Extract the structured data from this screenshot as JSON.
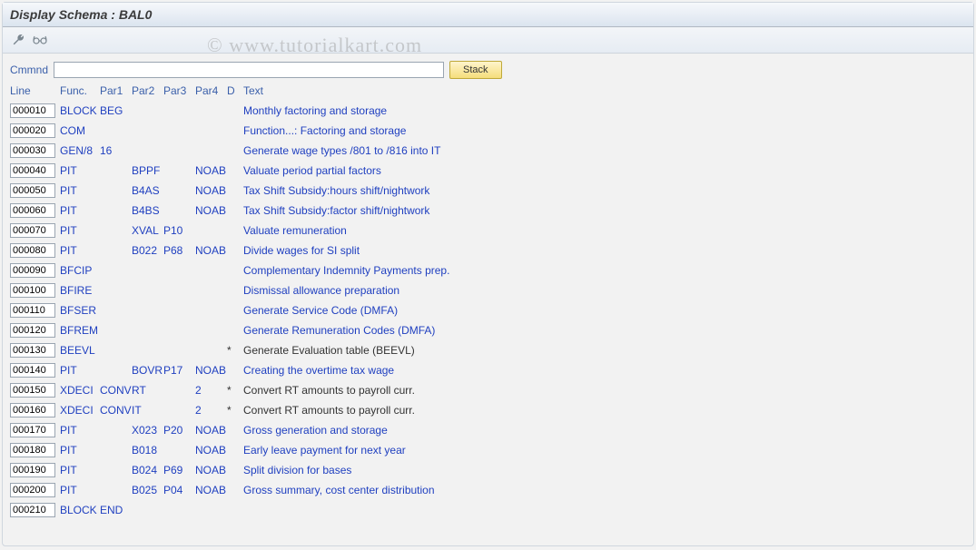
{
  "title": "Display Schema : BAL0",
  "watermark": "© www.tutorialkart.com",
  "toolbar": {
    "icon1_name": "wrench-icon",
    "icon2_name": "glasses-icon"
  },
  "command": {
    "label": "Cmmnd",
    "value": "",
    "stack_label": "Stack"
  },
  "headers": {
    "line": "Line",
    "func": "Func.",
    "par1": "Par1",
    "par2": "Par2",
    "par3": "Par3",
    "par4": "Par4",
    "d": "D",
    "text": "Text"
  },
  "rows": [
    {
      "line": "000010",
      "func": "BLOCK",
      "par1": "BEG",
      "par2": "",
      "par3": "",
      "par4": "",
      "d": "",
      "text": "Monthly factoring and storage"
    },
    {
      "line": "000020",
      "func": "COM",
      "par1": "",
      "par2": "",
      "par3": "",
      "par4": "",
      "d": "",
      "text": "Function...: Factoring and storage"
    },
    {
      "line": "000030",
      "func": "GEN/8",
      "par1": "16",
      "par2": "",
      "par3": "",
      "par4": "",
      "d": "",
      "text": "Generate wage types /801 to /816 into IT"
    },
    {
      "line": "000040",
      "func": "PIT",
      "par1": "",
      "par2": "BPPF",
      "par3": "",
      "par4": "NOAB",
      "d": "",
      "text": "Valuate period partial factors"
    },
    {
      "line": "000050",
      "func": "PIT",
      "par1": "",
      "par2": "B4AS",
      "par3": "",
      "par4": "NOAB",
      "d": "",
      "text": "Tax Shift Subsidy:hours shift/nightwork"
    },
    {
      "line": "000060",
      "func": "PIT",
      "par1": "",
      "par2": "B4BS",
      "par3": "",
      "par4": "NOAB",
      "d": "",
      "text": "Tax Shift Subsidy:factor shift/nightwork"
    },
    {
      "line": "000070",
      "func": "PIT",
      "par1": "",
      "par2": "XVAL",
      "par3": "P10",
      "par4": "",
      "d": "",
      "text": "Valuate remuneration"
    },
    {
      "line": "000080",
      "func": "PIT",
      "par1": "",
      "par2": "B022",
      "par3": "P68",
      "par4": "NOAB",
      "d": "",
      "text": "Divide wages for SI split"
    },
    {
      "line": "000090",
      "func": "BFCIP",
      "par1": "",
      "par2": "",
      "par3": "",
      "par4": "",
      "d": "",
      "text": "Complementary Indemnity Payments prep."
    },
    {
      "line": "000100",
      "func": "BFIRE",
      "par1": "",
      "par2": "",
      "par3": "",
      "par4": "",
      "d": "",
      "text": "Dismissal allowance preparation"
    },
    {
      "line": "000110",
      "func": "BFSER",
      "par1": "",
      "par2": "",
      "par3": "",
      "par4": "",
      "d": "",
      "text": "Generate Service Code (DMFA)"
    },
    {
      "line": "000120",
      "func": "BFREM",
      "par1": "",
      "par2": "",
      "par3": "",
      "par4": "",
      "d": "",
      "text": "Generate Remuneration Codes (DMFA)"
    },
    {
      "line": "000130",
      "func": "BEEVL",
      "par1": "",
      "par2": "",
      "par3": "",
      "par4": "",
      "d": "*",
      "text": "Generate Evaluation table (BEEVL)"
    },
    {
      "line": "000140",
      "func": "PIT",
      "par1": "",
      "par2": "BOVR",
      "par3": "P17",
      "par4": "NOAB",
      "d": "",
      "text": "Creating the overtime tax wage"
    },
    {
      "line": "000150",
      "func": "XDECI",
      "par1": "CONV",
      "par2": "RT",
      "par3": "",
      "par4": "2",
      "d": "*",
      "text": "Convert RT amounts to payroll curr."
    },
    {
      "line": "000160",
      "func": "XDECI",
      "par1": "CONV",
      "par2": "IT",
      "par3": "",
      "par4": "2",
      "d": "*",
      "text": "Convert RT amounts to payroll curr."
    },
    {
      "line": "000170",
      "func": "PIT",
      "par1": "",
      "par2": "X023",
      "par3": "P20",
      "par4": "NOAB",
      "d": "",
      "text": "Gross generation and storage"
    },
    {
      "line": "000180",
      "func": "PIT",
      "par1": "",
      "par2": "B018",
      "par3": "",
      "par4": "NOAB",
      "d": "",
      "text": "Early leave payment for next year"
    },
    {
      "line": "000190",
      "func": "PIT",
      "par1": "",
      "par2": "B024",
      "par3": "P69",
      "par4": "NOAB",
      "d": "",
      "text": "Split division for bases"
    },
    {
      "line": "000200",
      "func": "PIT",
      "par1": "",
      "par2": "B025",
      "par3": "P04",
      "par4": "NOAB",
      "d": "",
      "text": "Gross summary, cost center distribution"
    },
    {
      "line": "000210",
      "func": "BLOCK",
      "par1": "END",
      "par2": "",
      "par3": "",
      "par4": "",
      "d": "",
      "text": ""
    }
  ]
}
